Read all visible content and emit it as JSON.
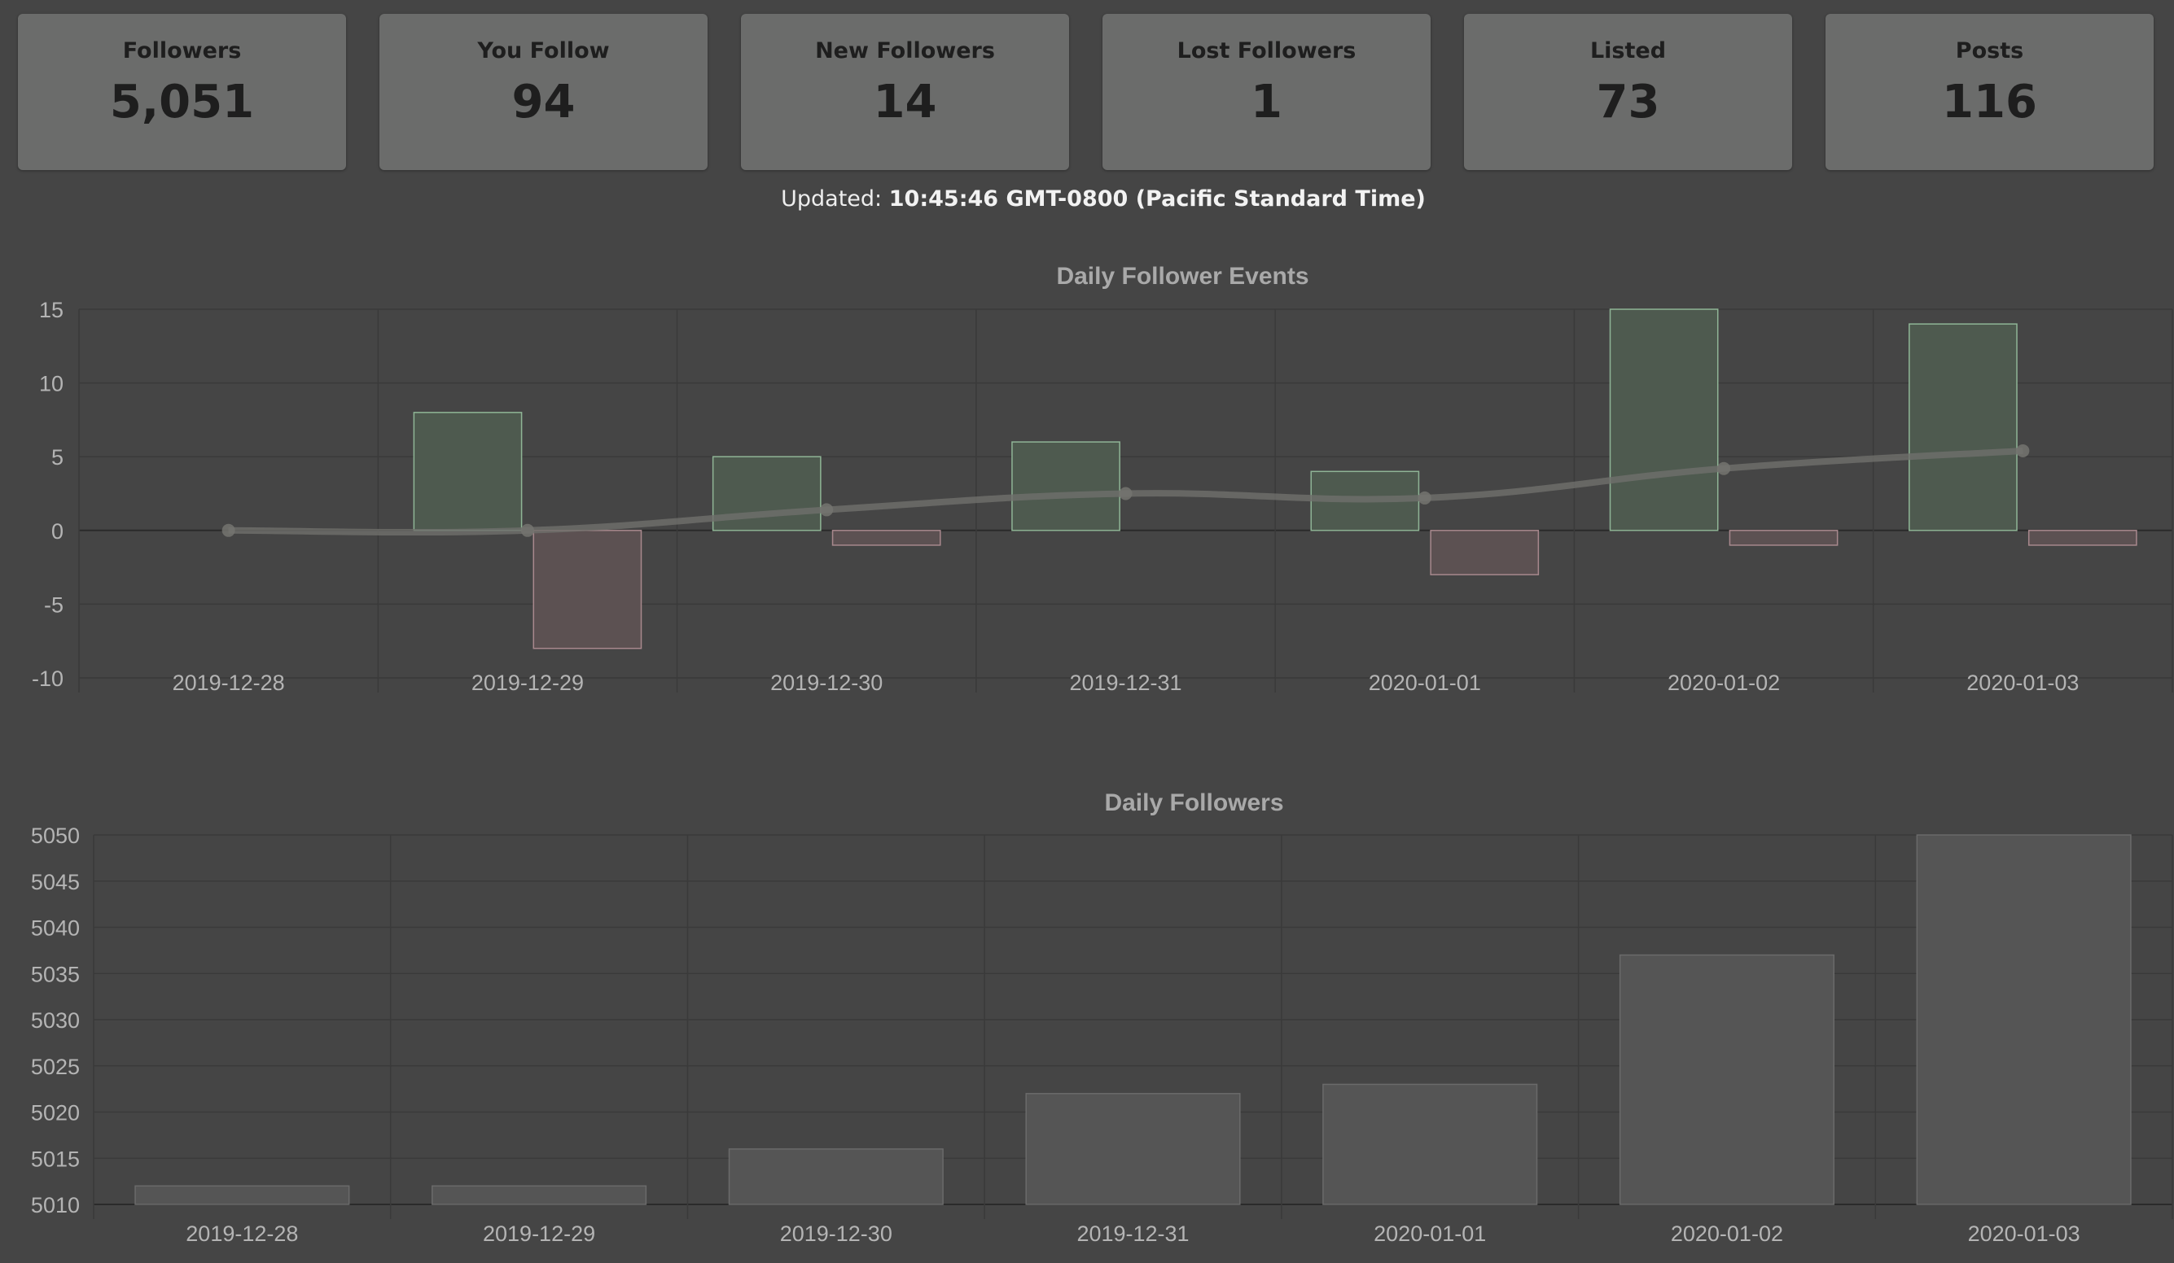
{
  "stats": {
    "cards": [
      {
        "label": "Followers",
        "value": "5,051"
      },
      {
        "label": "You Follow",
        "value": "94"
      },
      {
        "label": "New Followers",
        "value": "14"
      },
      {
        "label": "Lost Followers",
        "value": "1"
      },
      {
        "label": "Listed",
        "value": "73"
      },
      {
        "label": "Posts",
        "value": "116"
      }
    ],
    "updated_label": "Updated:",
    "updated_value": "10:45:46 GMT-0800 (Pacific Standard Time)"
  },
  "colors": {
    "background": "#454545",
    "card": "#6b6c6b",
    "new_fill": "#4e5a4f",
    "new_stroke": "#8fb596",
    "lost_fill": "#5c5152",
    "lost_stroke": "#a8888d",
    "trend": "#6f6f6b",
    "follower_bar_fill": "#555555",
    "follower_bar_stroke": "#6a6a6a"
  },
  "chart_data": [
    {
      "type": "bar",
      "title": "Daily Follower Events",
      "categories": [
        "2019-12-28",
        "2019-12-29",
        "2019-12-30",
        "2019-12-31",
        "2020-01-01",
        "2020-01-02",
        "2020-01-03"
      ],
      "series": [
        {
          "kind": "bar",
          "values": [
            0,
            8,
            5,
            6,
            4,
            15,
            14
          ]
        },
        {
          "kind": "bar",
          "values": [
            0,
            -8,
            -1,
            0,
            -3,
            -1,
            -1
          ]
        },
        {
          "kind": "line",
          "values": [
            0,
            0,
            1.4,
            2.5,
            2.2,
            4.2,
            5.4
          ]
        }
      ],
      "yticks": [
        15,
        10,
        5,
        0,
        -5,
        -10
      ],
      "ylim": [
        -10,
        15
      ],
      "grid": true,
      "legend": "none"
    },
    {
      "type": "bar",
      "title": "Daily Followers",
      "categories": [
        "2019-12-28",
        "2019-12-29",
        "2019-12-30",
        "2019-12-31",
        "2020-01-01",
        "2020-01-02",
        "2020-01-03"
      ],
      "series": [
        {
          "values": [
            5012,
            5012,
            5016,
            5022,
            5023,
            5037,
            5050
          ]
        }
      ],
      "yticks": [
        5050,
        5045,
        5040,
        5035,
        5030,
        5025,
        5020,
        5015,
        5010
      ],
      "ylim": [
        5010,
        5050
      ],
      "grid": true,
      "legend": "none"
    }
  ]
}
